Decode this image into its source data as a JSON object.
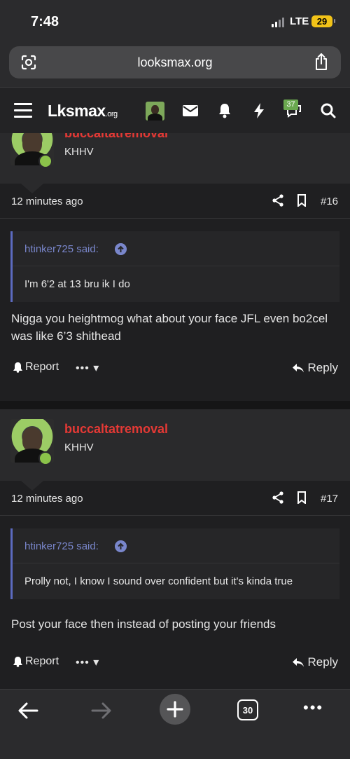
{
  "status": {
    "time": "7:48",
    "network": "LTE",
    "battery": "29"
  },
  "browser": {
    "url": "looksmax.org",
    "tab_count": "30"
  },
  "site": {
    "logo_main": "Lksmax",
    "logo_suffix": ".org",
    "alerts_badge": "37"
  },
  "posts": [
    {
      "username": "buccaltatremoval",
      "user_title": "KHHV",
      "date": "12 minutes ago",
      "post_number": "#16",
      "quote_author": "htinker725 said:",
      "quote_text": "I'm 6'2 at 13 bru ik I do",
      "message": "Nigga you heightmog what about your face JFL even bo2cel was like 6’3 shithead",
      "report_label": "Report",
      "reply_label": "Reply"
    },
    {
      "username": "buccaltatremoval",
      "user_title": "KHHV",
      "date": "12 minutes ago",
      "post_number": "#17",
      "quote_author": "htinker725 said:",
      "quote_text": "Prolly not, I know I sound over confident but it's kinda true",
      "message": "Post your face then instead of posting your friends",
      "report_label": "Report",
      "reply_label": "Reply"
    }
  ],
  "colors": {
    "username": "#e53935",
    "online": "#8bc34a",
    "quote_accent": "#7986cb",
    "badge": "#6aa84f"
  },
  "icons": [
    "scan-icon",
    "share-icon",
    "menu-icon",
    "user-avatar",
    "inbox-icon",
    "bell-icon",
    "lightning-icon",
    "chat-icon",
    "search-icon",
    "bookmark-icon",
    "arrow-up-icon",
    "report-icon",
    "more-icon",
    "reply-icon",
    "back-icon",
    "forward-icon",
    "plus-icon",
    "tabs-icon",
    "ellipsis-icon"
  ]
}
